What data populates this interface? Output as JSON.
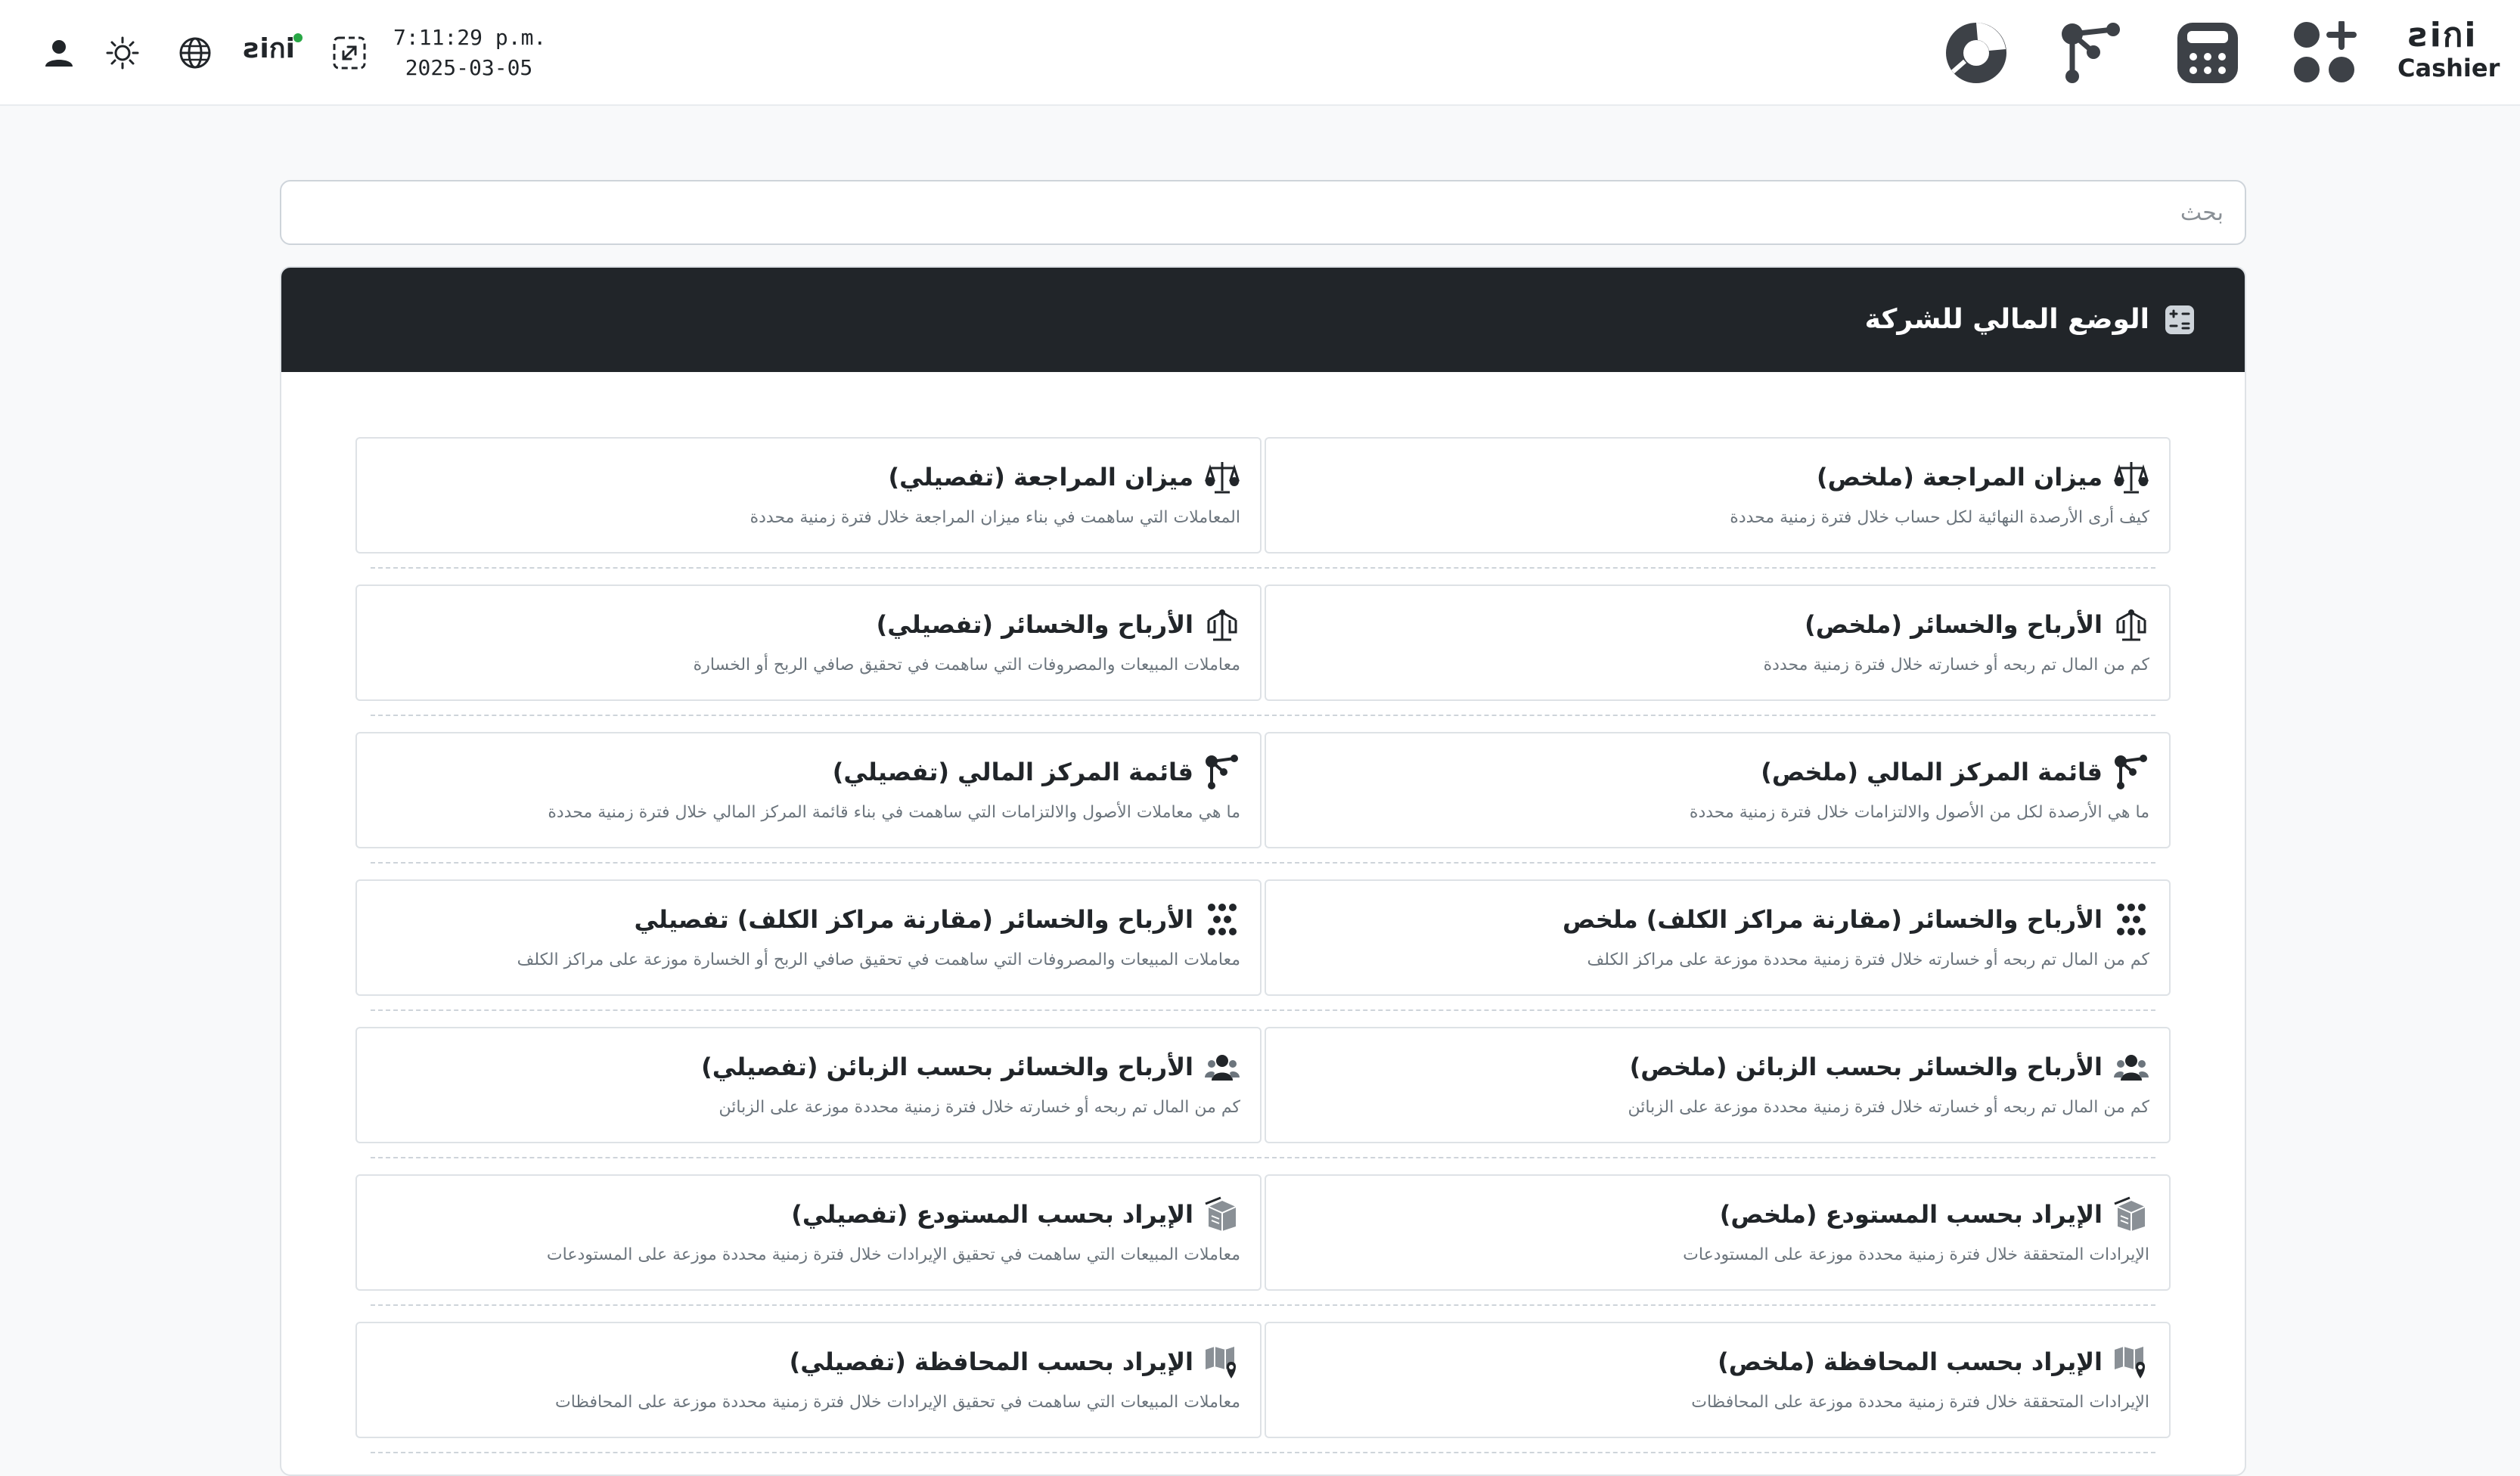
{
  "brand": {
    "wordmark": "ƨiกi",
    "sub": "Cashier"
  },
  "topbar": {
    "time": "7:11:29 p.m.",
    "date": "2025-03-05",
    "small_logo": "ƨiกi",
    "right_icons": [
      "pie-chart-icon",
      "graph-nodes-icon",
      "calculator-icon",
      "apps-add-icon"
    ],
    "left_icons": [
      "user-icon",
      "sun-icon",
      "globe-icon",
      "expand-icon"
    ],
    "colors": {
      "status_dot": "#28a745"
    }
  },
  "search": {
    "placeholder": "بحث"
  },
  "section": {
    "title": "الوضع المالي للشركة",
    "icon": "calculator-icon"
  },
  "reports": [
    {
      "summary": {
        "title": "ميزان المراجعة (ملخص)",
        "desc": "كيف أرى الأرصدة النهائية لكل حساب خلال فترة زمنية محددة",
        "icon": "scale-icon"
      },
      "detail": {
        "title": "ميزان المراجعة (تفصيلي)",
        "desc": "المعاملات التي ساهمت في بناء ميزان المراجعة خلال فترة زمنية محددة",
        "icon": "scale-icon"
      }
    },
    {
      "summary": {
        "title": "الأرباح والخسائر (ملخص)",
        "desc": "كم من المال تم ربحه أو خسارته خلال فترة زمنية محددة",
        "icon": "balance-scale-icon"
      },
      "detail": {
        "title": "الأرباح والخسائر (تفصيلي)",
        "desc": "معاملات المبيعات والمصروفات التي ساهمت في تحقيق صافي الربح أو الخسارة",
        "icon": "balance-scale-icon"
      }
    },
    {
      "summary": {
        "title": "قائمة المركز المالي (ملخص)",
        "desc": "ما هي الأرصدة لكل من الأصول والالتزامات خلال فترة زمنية محددة",
        "icon": "graph-nodes-icon"
      },
      "detail": {
        "title": "قائمة المركز المالي (تفصيلي)",
        "desc": "ما هي معاملات الأصول والالتزامات التي ساهمت في بناء قائمة المركز المالي خلال فترة زمنية محددة",
        "icon": "graph-nodes-icon"
      }
    },
    {
      "summary": {
        "title": "الأرباح والخسائر (مقارنة مراكز الكلف) ملخص",
        "desc": "كم من المال تم ربحه أو خسارته خلال فترة زمنية محددة موزعة على مراكز الكلف",
        "icon": "dots-grid-icon"
      },
      "detail": {
        "title": "الأرباح والخسائر (مقارنة مراكز الكلف) تفصيلي",
        "desc": "معاملات المبيعات والمصروفات التي ساهمت في تحقيق صافي الربح أو الخسارة موزعة على مراكز الكلف",
        "icon": "dots-grid-icon"
      }
    },
    {
      "summary": {
        "title": "الأرباح والخسائر بحسب الزبائن (ملخص)",
        "desc": "كم من المال تم ربحه أو خسارته خلال فترة زمنية محددة موزعة على الزبائن",
        "icon": "users-icon"
      },
      "detail": {
        "title": "الأرباح والخسائر بحسب الزبائن (تفصيلي)",
        "desc": "كم من المال تم ربحه أو خسارته خلال فترة زمنية محددة موزعة على الزبائن",
        "icon": "users-icon"
      }
    },
    {
      "summary": {
        "title": "الإيراد بحسب المستودع (ملخص)",
        "desc": "الإيرادات المتحققة خلال فترة زمنية محددة موزعة على المستودعات",
        "icon": "warehouse-boxes-icon"
      },
      "detail": {
        "title": "الإيراد بحسب المستودع (تفصيلي)",
        "desc": "معاملات المبيعات التي ساهمت في تحقيق الإيرادات خلال فترة زمنية محددة موزعة على المستودعات",
        "icon": "warehouse-boxes-icon"
      }
    },
    {
      "summary": {
        "title": "الإيراد بحسب المحافظة (ملخص)",
        "desc": "الإيرادات المتحققة خلال فترة زمنية محددة موزعة على المحافظات",
        "icon": "map-pin-icon"
      },
      "detail": {
        "title": "الإيراد بحسب المحافظة (تفصيلي)",
        "desc": "معاملات المبيعات التي ساهمت في تحقيق الإيرادات خلال فترة زمنية محددة موزعة على المحافظات",
        "icon": "map-pin-icon"
      }
    }
  ]
}
